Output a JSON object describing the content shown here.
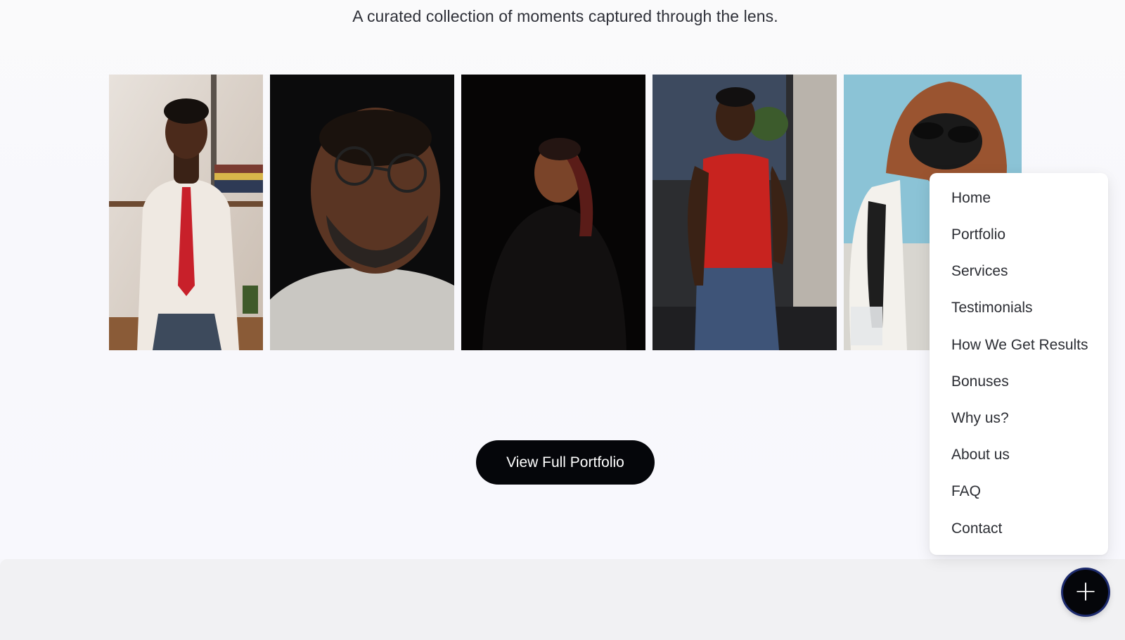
{
  "hero": {
    "subtitle": "A curated collection of moments captured through the lens."
  },
  "gallery": {
    "photos": [
      {
        "name": "man-red-tie-portrait"
      },
      {
        "name": "man-glasses-portrait"
      },
      {
        "name": "woman-dark-background-portrait"
      },
      {
        "name": "man-red-tank-top-portrait"
      },
      {
        "name": "person-orange-hood-sunglasses-portrait"
      }
    ]
  },
  "cta": {
    "label": "View Full Portfolio"
  },
  "menu": {
    "items": [
      {
        "label": "Home"
      },
      {
        "label": "Portfolio"
      },
      {
        "label": "Services"
      },
      {
        "label": "Testimonials"
      },
      {
        "label": "How We Get Results"
      },
      {
        "label": "Bonuses"
      },
      {
        "label": "Why us?"
      },
      {
        "label": "About us"
      },
      {
        "label": "FAQ"
      },
      {
        "label": "Contact"
      }
    ]
  },
  "fab": {
    "icon": "plus-icon",
    "color": "#05060a"
  }
}
